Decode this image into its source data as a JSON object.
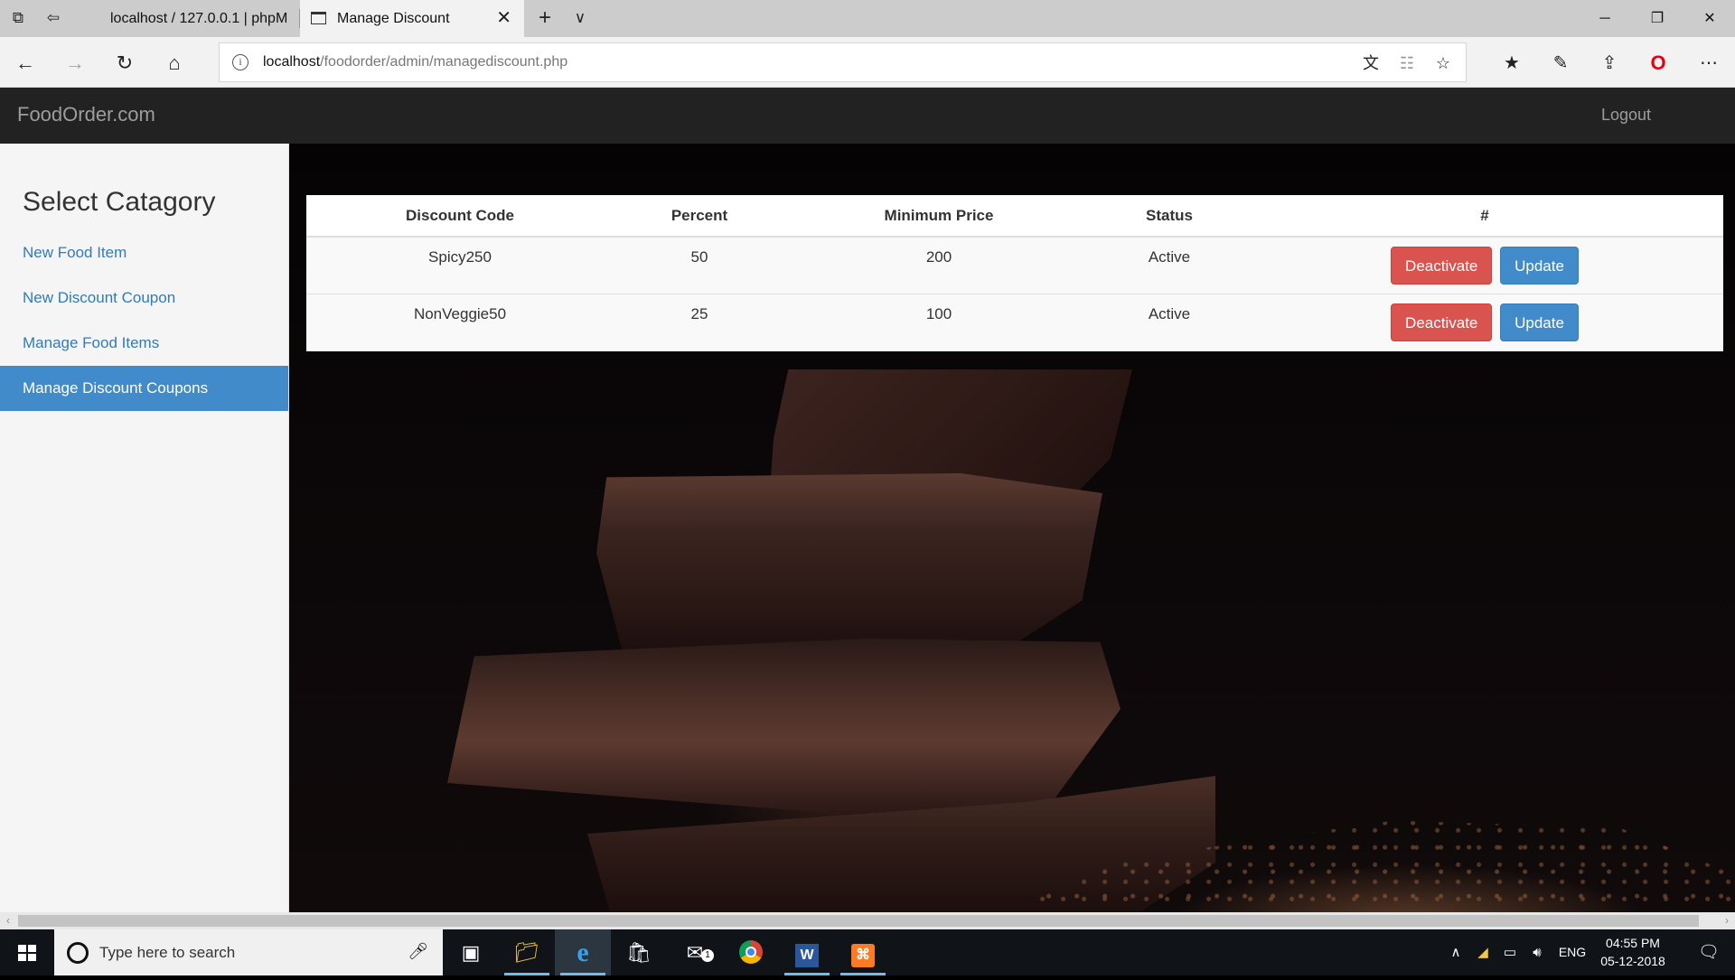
{
  "browser": {
    "tabs": [
      {
        "title": "localhost / 127.0.0.1 | phpM"
      },
      {
        "title": "Manage Discount"
      }
    ],
    "url_host": "localhost",
    "url_path": "/foodorder/admin/managediscount.php"
  },
  "navbar": {
    "brand": "FoodOrder.com",
    "logout": "Logout"
  },
  "sidebar": {
    "title": "Select Catagory",
    "items": [
      {
        "label": "New Food Item"
      },
      {
        "label": "New Discount Coupon"
      },
      {
        "label": "Manage Food Items"
      },
      {
        "label": "Manage Discount Coupons"
      }
    ]
  },
  "table": {
    "headers": [
      "Discount Code",
      "Percent",
      "Minimum Price",
      "Status",
      "#"
    ],
    "rows": [
      {
        "code": "Spicy250",
        "percent": "50",
        "min_price": "200",
        "status": "Active",
        "action1": "Deactivate",
        "action2": "Update"
      },
      {
        "code": "NonVeggie50",
        "percent": "25",
        "min_price": "100",
        "status": "Active",
        "action1": "Deactivate",
        "action2": "Update"
      }
    ]
  },
  "taskbar": {
    "search_placeholder": "Type here to search",
    "language": "ENG",
    "time": "04:55 PM",
    "date": "05-12-2018",
    "mail_badge": "1"
  },
  "colors": {
    "navbar_bg": "#222222",
    "sidebar_active": "#428bca",
    "link": "#337ab7",
    "danger": "#d9534f",
    "primary": "#428bca"
  }
}
